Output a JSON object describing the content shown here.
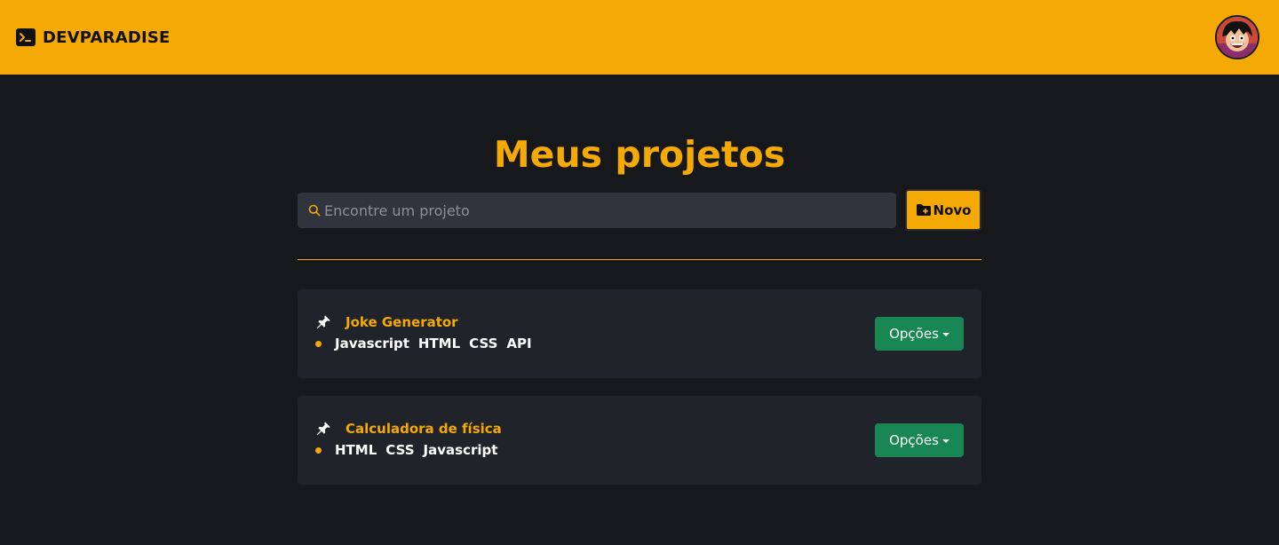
{
  "navbar": {
    "brand_name": "DEVPARADISE"
  },
  "main": {
    "title": "Meus projetos",
    "search": {
      "placeholder": "Encontre um projeto",
      "value": ""
    },
    "new_button_label": "Novo"
  },
  "projects": [
    {
      "name": "Joke Generator",
      "tags": [
        "Javascript",
        "HTML",
        "CSS",
        "API"
      ],
      "options_label": "Opções"
    },
    {
      "name": "Calculadora de física",
      "tags": [
        "HTML",
        "CSS",
        "Javascript"
      ],
      "options_label": "Opções"
    }
  ],
  "icons": {
    "brand": "terminal-icon",
    "search": "search-icon",
    "new": "folder-plus-icon",
    "pin": "pin-icon",
    "options_caret": "caret-down-icon"
  },
  "colors": {
    "accent": "#f5a905",
    "background": "#17181c",
    "card": "#21232a",
    "search_bg": "#30343d",
    "options_button": "#198754"
  }
}
